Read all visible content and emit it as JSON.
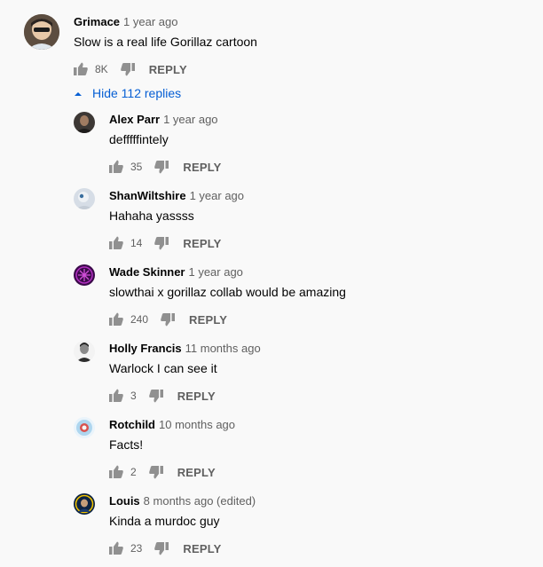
{
  "top_comment": {
    "author": "Grimace",
    "time": "1 year ago",
    "text": "Slow is a real life Gorillaz cartoon",
    "likes": "8K",
    "reply_label": "REPLY"
  },
  "hide_replies_label": "Hide 112 replies",
  "replies": [
    {
      "author": "Alex Parr",
      "time": "1 year ago",
      "text": "defffffintely",
      "likes": "35",
      "reply_label": "REPLY"
    },
    {
      "author": "ShanWiltshire",
      "time": "1 year ago",
      "text": "Hahaha yassss",
      "likes": "14",
      "reply_label": "REPLY"
    },
    {
      "author": "Wade Skinner",
      "time": "1 year ago",
      "text": "slowthai x gorillaz collab would be amazing",
      "likes": "240",
      "reply_label": "REPLY"
    },
    {
      "author": "Holly Francis",
      "time": "11 months ago",
      "text": "Warlock I can see it",
      "likes": "3",
      "reply_label": "REPLY"
    },
    {
      "author": "Rotchild",
      "time": "10 months ago",
      "text": "Facts!",
      "likes": "2",
      "reply_label": "REPLY"
    },
    {
      "author": "Louis",
      "time": "8 months ago (edited)",
      "text": "Kinda a murdoc guy",
      "likes": "23",
      "reply_label": "REPLY"
    }
  ],
  "colors": {
    "link_blue": "#065fd4",
    "secondary_text": "#606060",
    "icon_gray": "#909090",
    "background": "#f9f9f9"
  },
  "icons": {
    "like": "thumbs-up-icon",
    "dislike": "thumbs-down-icon",
    "collapse": "chevron-up-icon"
  }
}
